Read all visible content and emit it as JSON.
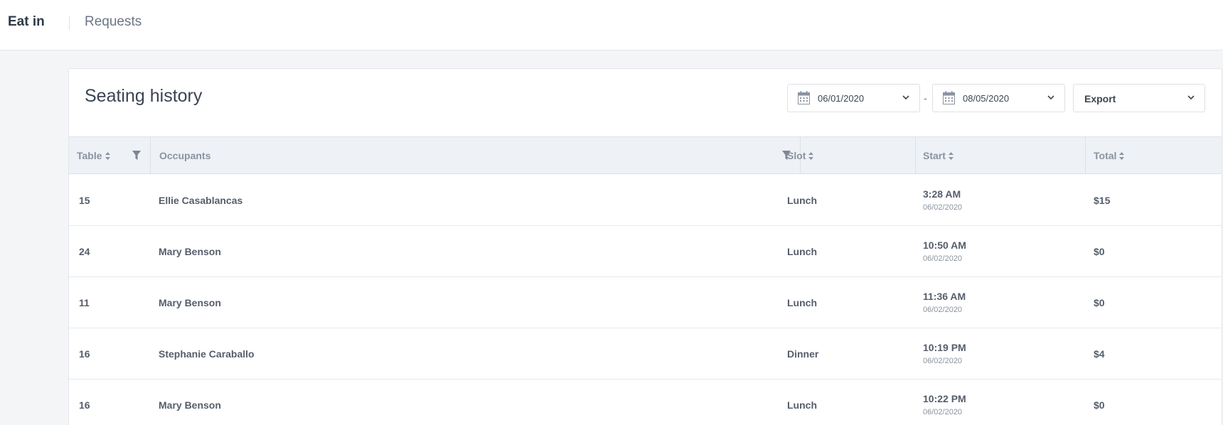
{
  "nav": {
    "tabs": [
      {
        "label": "Eat in",
        "active": true
      },
      {
        "label": "Requests",
        "active": false
      }
    ]
  },
  "card": {
    "title": "Seating history",
    "date_from": "06/01/2020",
    "date_separator": "-",
    "date_to": "08/05/2020",
    "export_label": "Export"
  },
  "table": {
    "columns": {
      "table": "Table",
      "occupants": "Occupants",
      "slot": "Slot",
      "start": "Start",
      "total": "Total"
    },
    "rows": [
      {
        "table": "15",
        "occupants": "Ellie Casablancas",
        "slot": "Lunch",
        "start_time": "3:28 AM",
        "start_date": "06/02/2020",
        "total": "$15"
      },
      {
        "table": "24",
        "occupants": "Mary Benson",
        "slot": "Lunch",
        "start_time": "10:50 AM",
        "start_date": "06/02/2020",
        "total": "$0"
      },
      {
        "table": "11",
        "occupants": "Mary Benson",
        "slot": "Lunch",
        "start_time": "11:36 AM",
        "start_date": "06/02/2020",
        "total": "$0"
      },
      {
        "table": "16",
        "occupants": "Stephanie Caraballo",
        "slot": "Dinner",
        "start_time": "10:19 PM",
        "start_date": "06/02/2020",
        "total": "$4"
      },
      {
        "table": "16",
        "occupants": "Mary Benson",
        "slot": "Lunch",
        "start_time": "10:22 PM",
        "start_date": "06/02/2020",
        "total": "$0"
      }
    ]
  },
  "colors": {
    "background": "#f4f5f7",
    "header_bg": "#eef1f5",
    "text_primary": "#3d4552",
    "text_muted": "#8a93a1"
  }
}
